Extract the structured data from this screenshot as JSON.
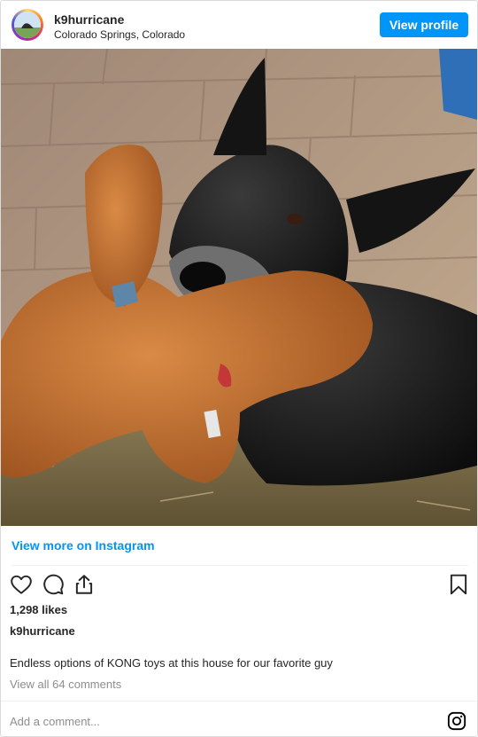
{
  "header": {
    "username": "k9hurricane",
    "location": "Colorado Springs, Colorado",
    "view_profile_label": "View profile",
    "accent_color": "#0095f6"
  },
  "post": {
    "image_icon": "dog-with-toy-photo",
    "view_more_label": "View more on Instagram",
    "likes": "1,298 likes",
    "caption_username": "k9hurricane",
    "caption": "Endless options of KONG toys at this house for our favorite guy",
    "comments_link": "View all 64 comments"
  },
  "actions": {
    "icons": [
      "heart-icon",
      "comment-icon",
      "share-icon",
      "bookmark-icon"
    ]
  },
  "footer": {
    "comment_placeholder": "Add a comment...",
    "logo_icon": "instagram-icon"
  }
}
